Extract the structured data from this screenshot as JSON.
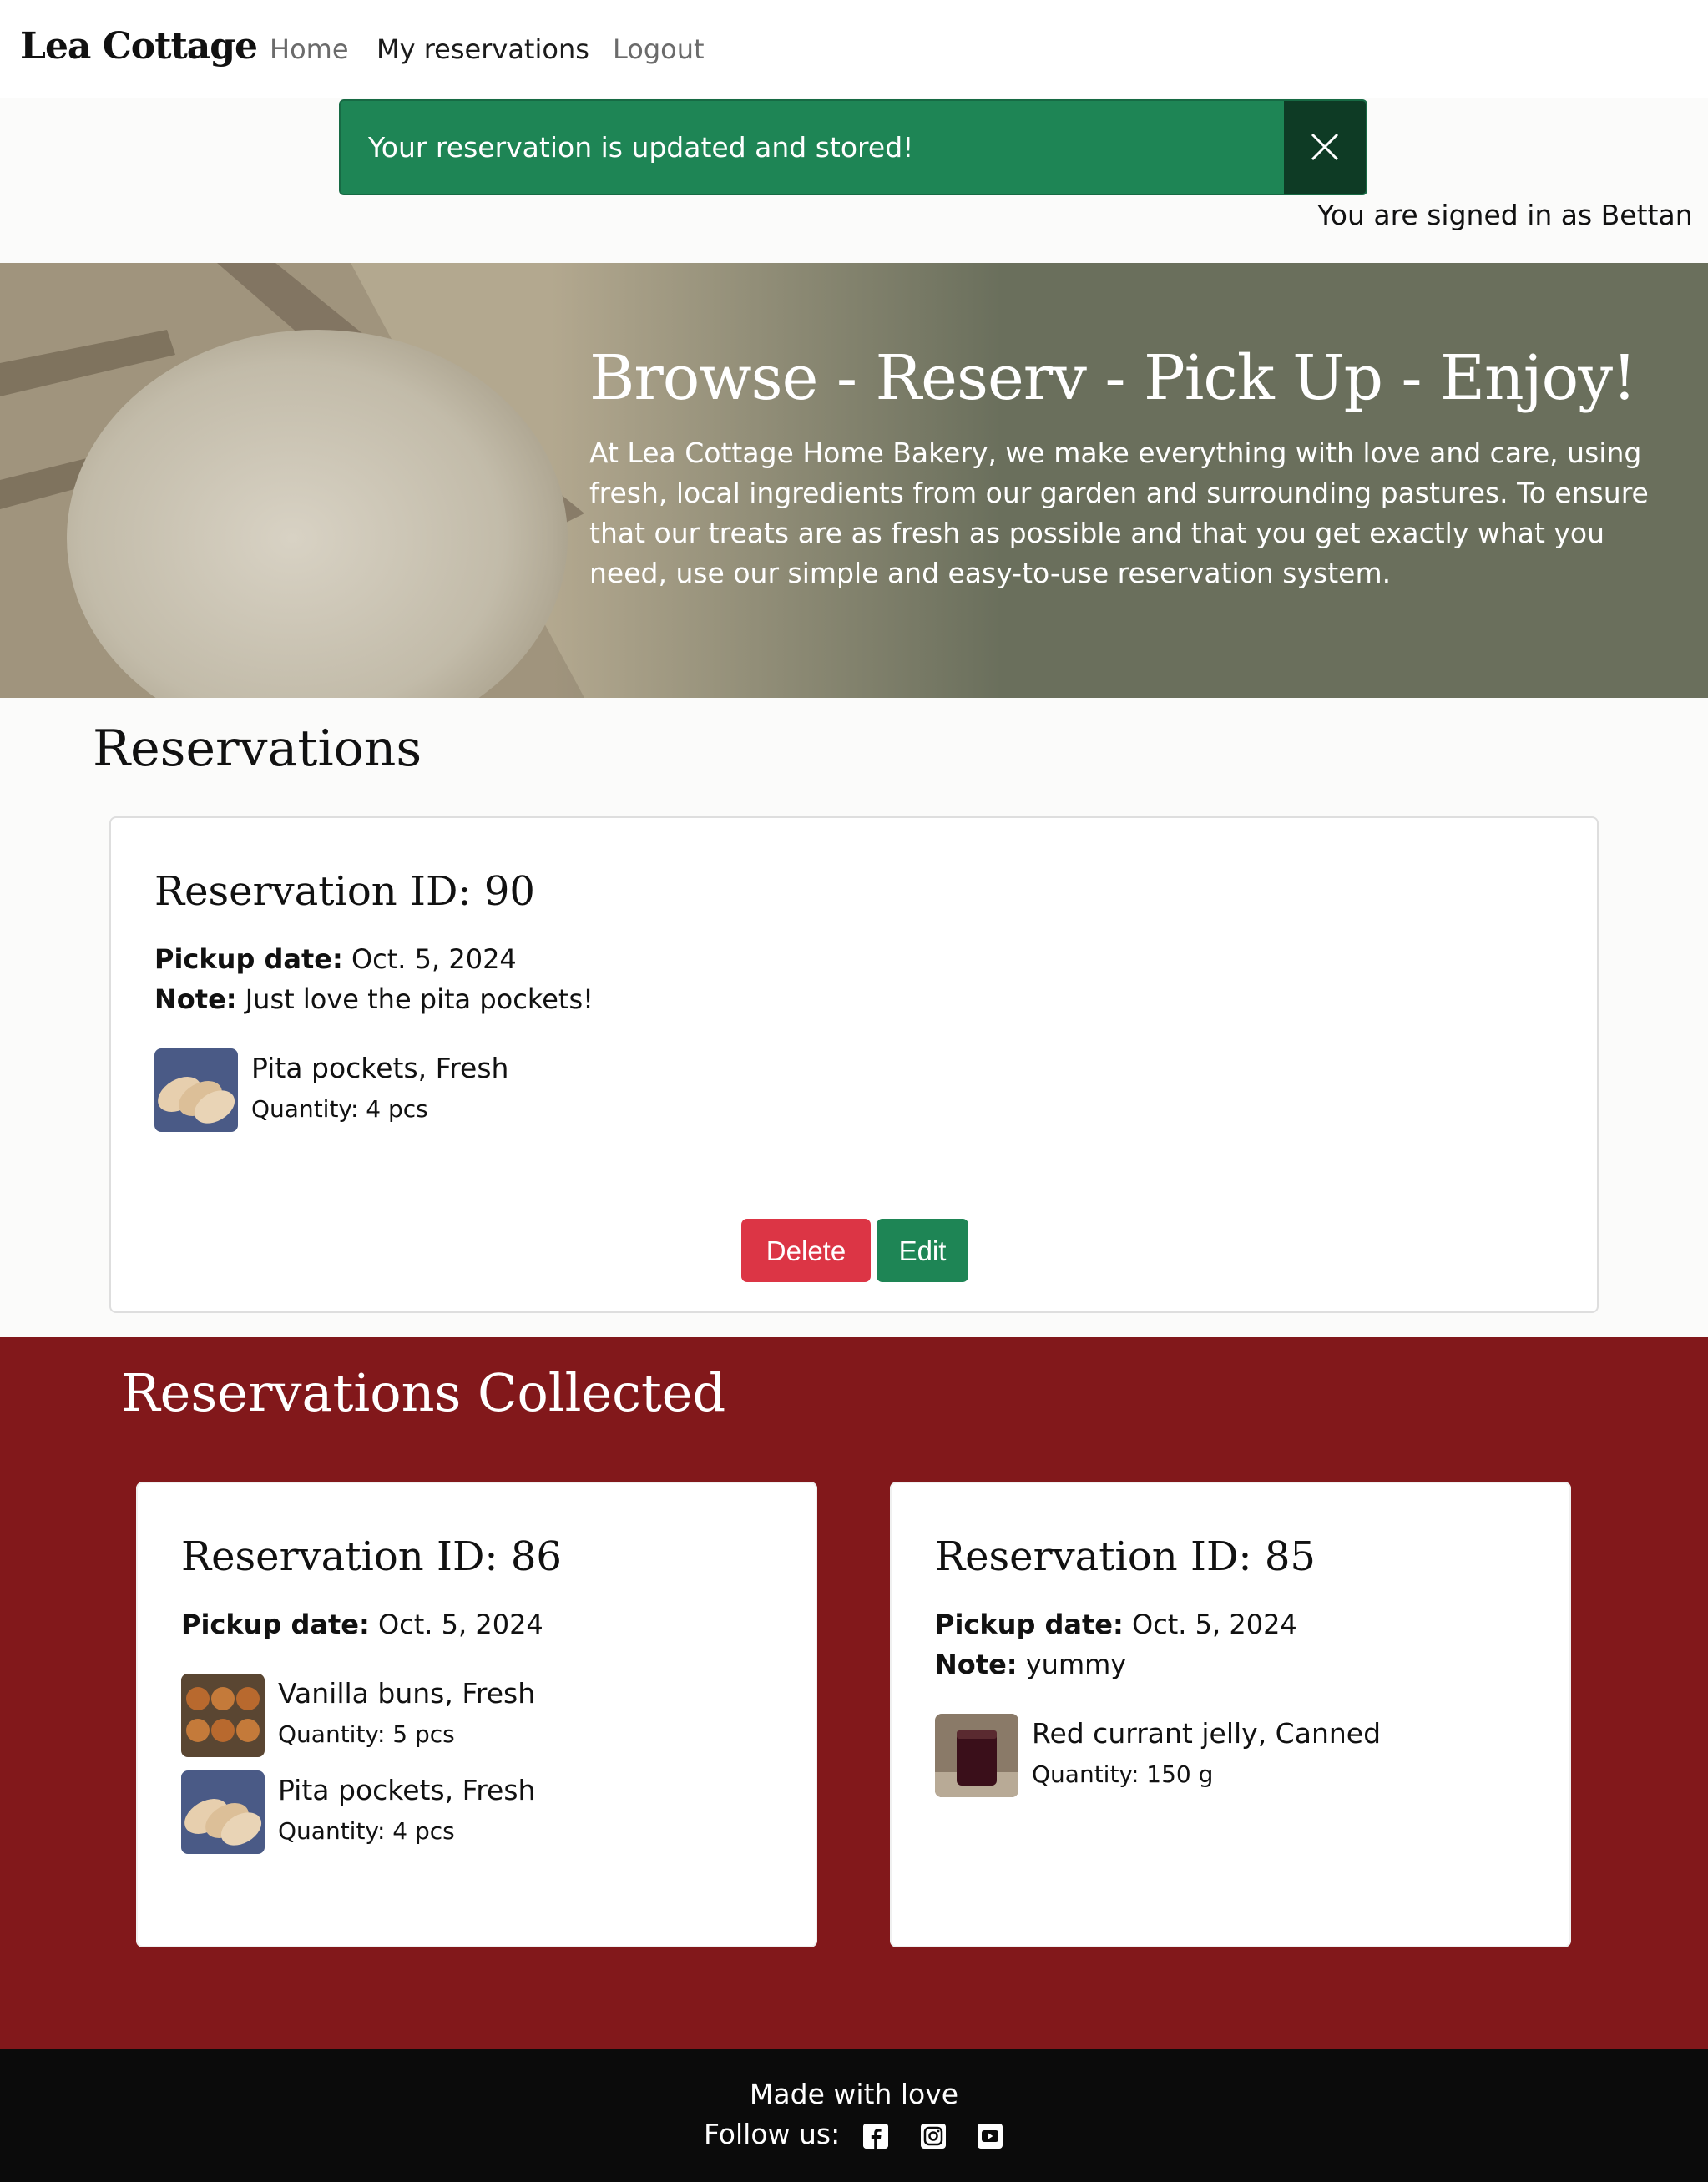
{
  "navbar": {
    "brand": "Lea Cottage",
    "links": [
      "Home",
      "My reservations",
      "Logout"
    ]
  },
  "alert": {
    "message": "Your reservation is updated and stored!",
    "close_icon": "close-icon"
  },
  "user": {
    "signed_in_text": "You are signed in as Bettan"
  },
  "hero": {
    "title": "Browse - Reserv - Pick Up - Enjoy!",
    "text": "At Lea Cottage Home Bakery, we make everything with love and care, using fresh, local ingredients from our garden and surrounding pastures. To ensure that our treats are as fresh as possible and that you get exactly what you need, use our simple and easy-to-use reservation system."
  },
  "reservations": {
    "heading": "Reservations",
    "cards": [
      {
        "title": "Reservation ID: 90",
        "pickup_label": "Pickup date:",
        "pickup_date": "Oct. 5, 2024",
        "note_label": "Note:",
        "note": "Just love the pita pockets!",
        "items": [
          {
            "name": "Pita pockets, Fresh",
            "qty": "Quantity: 4 pcs",
            "thumb": "pita-pockets-image"
          }
        ],
        "delete_label": "Delete",
        "edit_label": "Edit"
      }
    ]
  },
  "collected": {
    "heading": "Reservations Collected",
    "cards": [
      {
        "title": "Reservation ID: 86",
        "pickup_label": "Pickup date:",
        "pickup_date": "Oct. 5, 2024",
        "items": [
          {
            "name": "Vanilla buns, Fresh",
            "qty": "Quantity: 5 pcs",
            "thumb": "vanilla-buns-image"
          },
          {
            "name": "Pita pockets, Fresh",
            "qty": "Quantity: 4 pcs",
            "thumb": "pita-pockets-image"
          }
        ]
      },
      {
        "title": "Reservation ID: 85",
        "pickup_label": "Pickup date:",
        "pickup_date": "Oct. 5, 2024",
        "note_label": "Note:",
        "note": "yummy",
        "items": [
          {
            "name": "Red currant jelly, Canned",
            "qty": "Quantity: 150 g",
            "thumb": "red-currant-jelly-image"
          }
        ]
      }
    ]
  },
  "footer": {
    "made_with": "Made with love",
    "follow": "Follow us:",
    "icons": [
      "facebook-icon",
      "instagram-icon",
      "youtube-icon"
    ]
  },
  "colors": {
    "success": "#1e8555",
    "danger": "#dc3545",
    "collected_bg": "#82181b",
    "hero_bg": "#6a6f5c",
    "footer_bg": "#0b0b0b"
  }
}
